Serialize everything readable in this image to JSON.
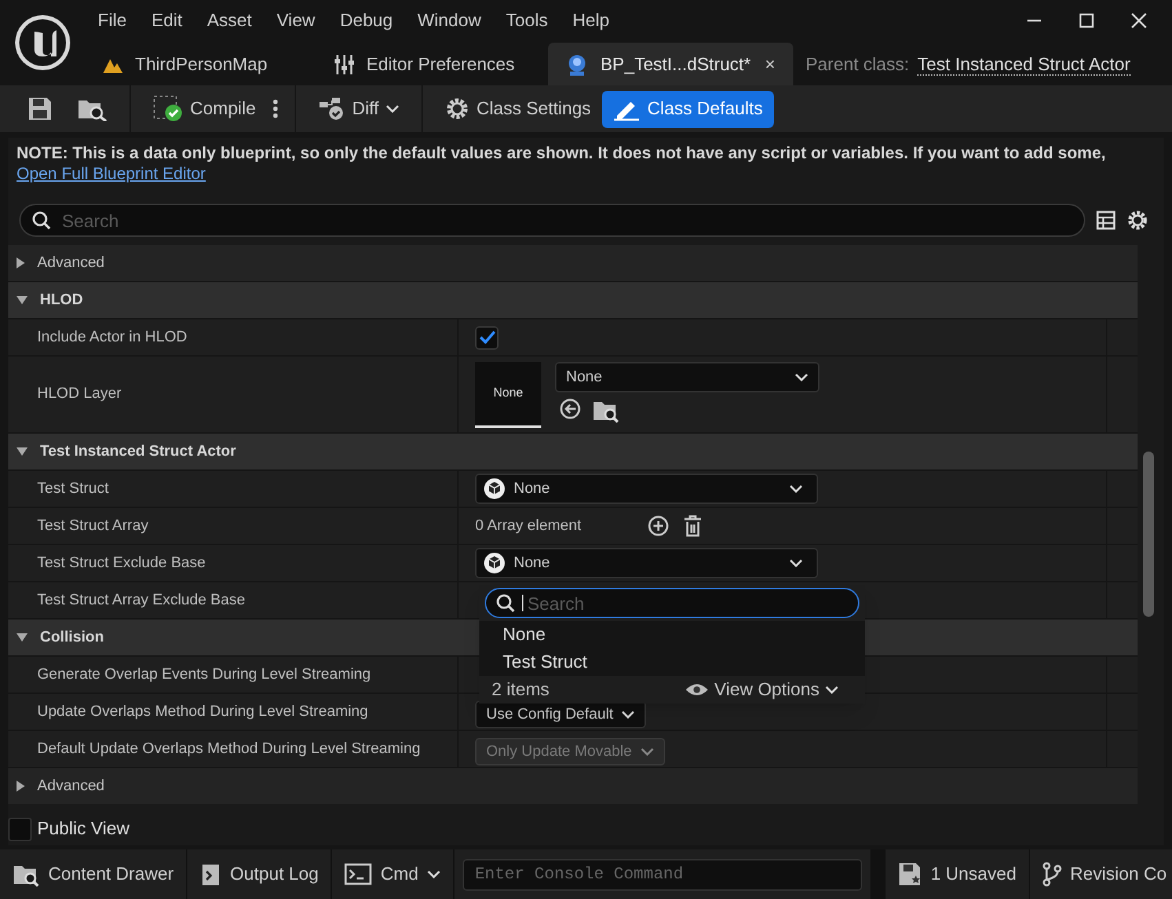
{
  "menu": [
    "File",
    "Edit",
    "Asset",
    "View",
    "Debug",
    "Window",
    "Tools",
    "Help"
  ],
  "tabs": [
    {
      "label": "ThirdPersonMap",
      "kind": "map",
      "selected": false
    },
    {
      "label": "Editor Preferences",
      "kind": "prefs",
      "selected": false
    },
    {
      "label": "BP_TestI...dStruct*",
      "kind": "blueprint",
      "selected": true,
      "close": "×"
    }
  ],
  "parent_class": {
    "label": "Parent class:",
    "value": "Test Instanced Struct Actor"
  },
  "toolbar": [
    {
      "kind": "save"
    },
    {
      "kind": "browse"
    },
    {
      "kind": "compile",
      "label": "Compile"
    },
    {
      "kind": "diff",
      "label": "Diff"
    },
    {
      "kind": "settings",
      "label": "Class Settings",
      "selected": false
    },
    {
      "kind": "defaults",
      "label": "Class Defaults",
      "selected": true
    }
  ],
  "note": {
    "text": "NOTE: This is a data only blueprint, so only the default values are shown.  It does not have any script or variables.  If you want to add some,",
    "link": "Open Full Blueprint Editor"
  },
  "search": {
    "placeholder": "Search"
  },
  "rows": [
    {
      "kind": "advanced",
      "label": "Advanced",
      "expanded": false
    },
    {
      "kind": "category",
      "label": "HLOD",
      "expanded": true,
      "children": [
        {
          "kind": "checkbox",
          "label": "Include Actor in HLOD",
          "checked": true
        },
        {
          "kind": "asset",
          "label": "HLOD Layer",
          "thumb": "None",
          "value": "None"
        }
      ]
    },
    {
      "kind": "category",
      "label": "Test Instanced Struct Actor",
      "expanded": true,
      "children": [
        {
          "kind": "struct",
          "label": "Test Struct",
          "value": "None"
        },
        {
          "kind": "array",
          "label": "Test Struct Array",
          "value": "0 Array element"
        },
        {
          "kind": "struct",
          "label": "Test Struct Exclude Base",
          "value": "None"
        },
        {
          "kind": "empty",
          "label": "Test Struct Array Exclude Base"
        }
      ]
    },
    {
      "kind": "category",
      "label": "Collision",
      "expanded": true,
      "children": [
        {
          "kind": "empty",
          "label": "Generate Overlap Events During Level Streaming"
        },
        {
          "kind": "enum",
          "label": "Update Overlaps Method During Level Streaming",
          "value": "Use Config Default",
          "disabled": false
        },
        {
          "kind": "enum",
          "label": "Default Update Overlaps Method During Level Streaming",
          "value": "Only Update Movable",
          "disabled": true
        },
        {
          "kind": "advanced",
          "label": "Advanced",
          "expanded": false
        }
      ]
    }
  ],
  "popup": {
    "search_placeholder": "Search",
    "items": [
      {
        "label": "None"
      },
      {
        "label": "Test Struct"
      }
    ],
    "count": "2 items",
    "view_options": "View Options"
  },
  "public_view": {
    "label": "Public View",
    "checked": false
  },
  "status_bar": [
    {
      "kind": "drawer",
      "label": "Content Drawer"
    },
    {
      "kind": "log",
      "label": "Output Log"
    },
    {
      "kind": "cmd",
      "label": "Cmd"
    },
    {
      "kind": "console",
      "placeholder": "Enter Console Command"
    },
    {
      "kind": "unsaved",
      "label": "1 Unsaved"
    },
    {
      "kind": "revision",
      "label": "Revision Co"
    }
  ]
}
